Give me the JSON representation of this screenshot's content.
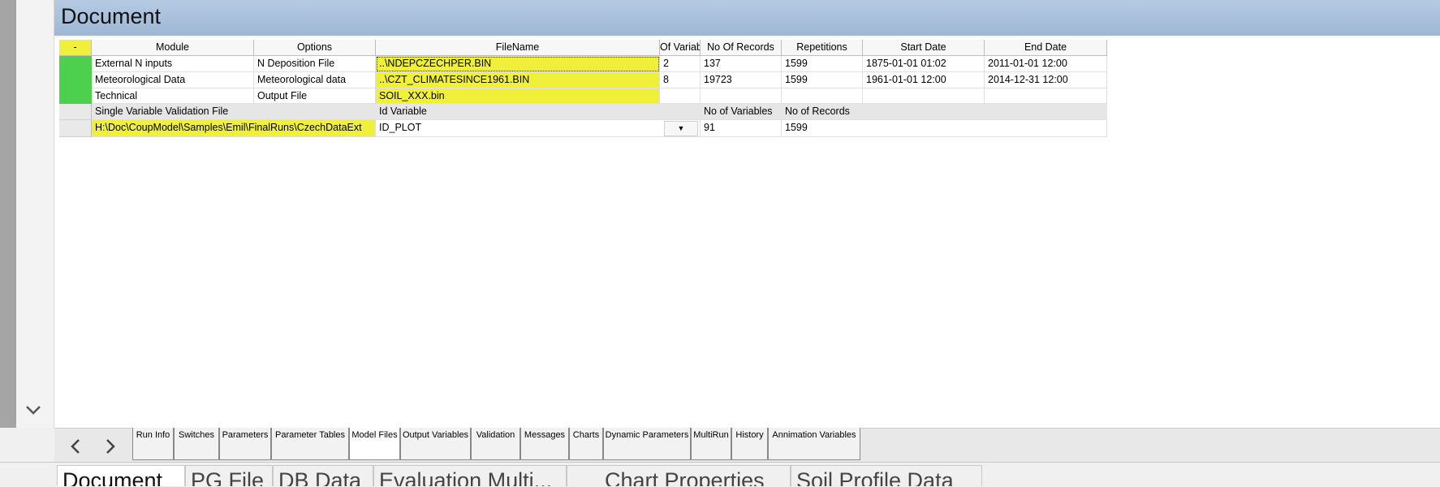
{
  "document": {
    "title": "Document"
  },
  "grid": {
    "corner": "-",
    "headers": [
      "Module",
      "Options",
      "FileName",
      "Of Variab",
      "No Of Records",
      "Repetitions",
      "Start Date",
      "End Date"
    ],
    "rows": [
      [
        "External N inputs",
        "N Deposition File",
        "..\\NDEPCZECHPER.BIN",
        "2",
        "137",
        "1599",
        "1875-01-01 01:02",
        "2011-01-01 12:00"
      ],
      [
        "Meteorological Data",
        "Meteorological data",
        "..\\CZT_CLIMATESINCE1961.BIN",
        "8",
        "19723",
        "1599",
        "1961-01-01 12:00",
        "2014-12-31 12:00"
      ],
      [
        "Technical",
        "Output File",
        "SOIL_XXX.bin",
        "",
        "",
        "",
        "",
        ""
      ]
    ],
    "validation_header": {
      "file_label": "Single Variable Validation File",
      "id_label": "Id Variable",
      "num_vars_label": "No of Variables",
      "num_records_label": "No of Records"
    },
    "validation_row": {
      "path": "H:\\Doc\\CoupModel\\Samples\\Emil\\FinalRuns\\CzechDataExt",
      "id_value": "ID_PLOT",
      "num_vars": "91",
      "num_records": "1599"
    }
  },
  "inner_tabs": [
    "Run Info",
    "Switches",
    "Parameters",
    "Parameter Tables",
    "Model Files",
    "Output Variables",
    "Validation",
    "Messages",
    "Charts",
    "Dynamic Parameters",
    "MultiRun",
    "History",
    "Annimation Variables"
  ],
  "inner_tabs_active": "Model Files",
  "doc_tabs": [
    "Document",
    "PG File",
    "DB Data",
    "Evaluation Multi...",
    "Chart Properties",
    "Soil Profile Data"
  ],
  "doc_tabs_active": "Document",
  "icons": {
    "prev": "chevron-left-icon",
    "next": "chevron-right-icon",
    "scroll": "chevron-down-icon",
    "dropdown": "caret-down-icon"
  },
  "colors": {
    "highlight": "#f0f03a",
    "status_green": "#4dd04d",
    "header_blue": "#a9c1dd"
  }
}
